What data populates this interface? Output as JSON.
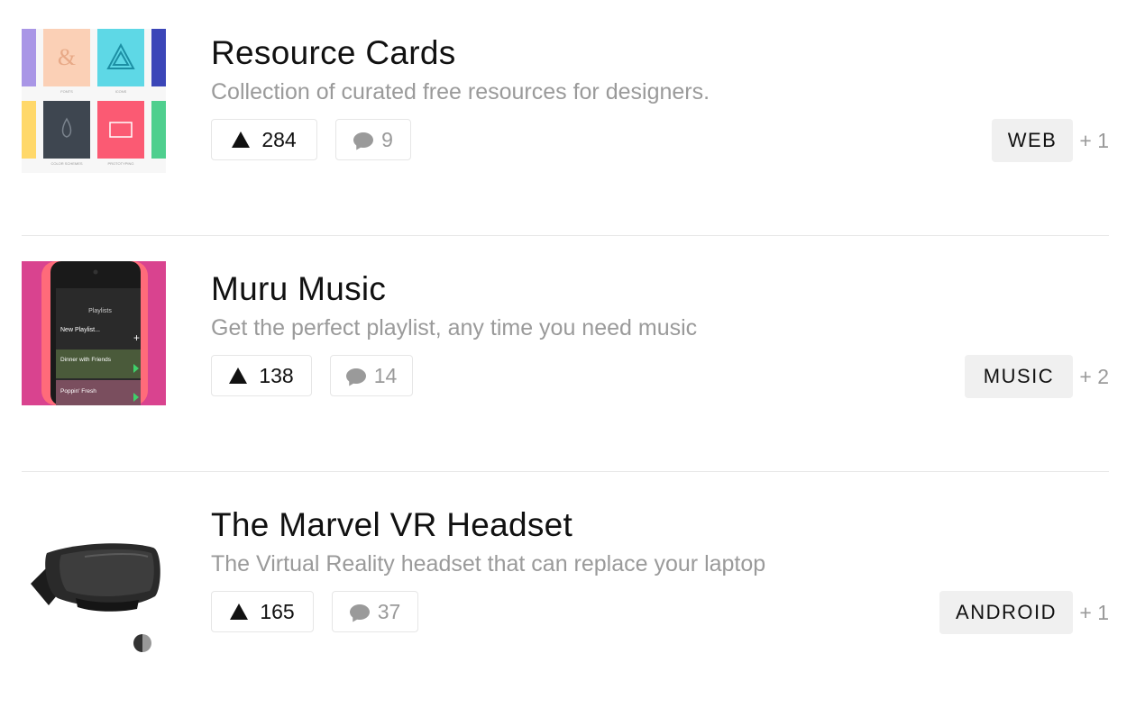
{
  "products": [
    {
      "title": "Resource Cards",
      "tagline": "Collection of curated free resources for designers.",
      "votes": "284",
      "comments": "9",
      "tag": "WEB",
      "more": "+ 1",
      "thumb_labels": [
        "FONTS",
        "ICONS",
        "COLOR SCHEMES",
        "PROTOTYPING"
      ]
    },
    {
      "title": "Muru Music",
      "tagline": "Get the perfect playlist, any time you need music",
      "votes": "138",
      "comments": "14",
      "tag": "MUSIC",
      "more": "+ 2",
      "thumb_labels": [
        "Playlists",
        "New Playlist...",
        "Dinner with Friends",
        "Poppin' Fresh"
      ]
    },
    {
      "title": "The Marvel VR Headset",
      "tagline": "The Virtual Reality headset that can replace your laptop",
      "votes": "165",
      "comments": "37",
      "tag": "ANDROID",
      "more": "+ 1"
    }
  ]
}
